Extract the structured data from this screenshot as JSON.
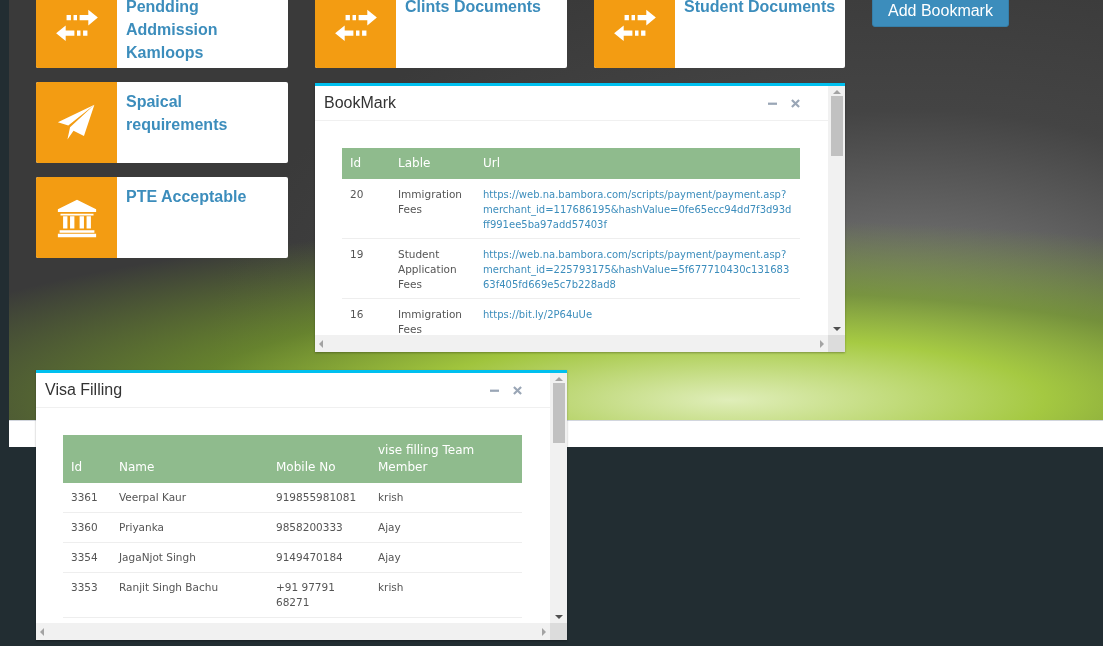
{
  "tiles": [
    {
      "title": "Pendding Addmission Kamloops",
      "kind": "exchange"
    },
    {
      "title": "Clints Documents",
      "kind": "exchange"
    },
    {
      "title": "Student Documents",
      "kind": "exchange"
    },
    {
      "title": "Spaical requirements",
      "kind": "plane"
    },
    {
      "title": "PTE Acceptable",
      "kind": "bank"
    }
  ],
  "add_button": "Add Bookmark",
  "windows": [
    {
      "title": "BookMark",
      "columns": [
        {
          "label": "Id",
          "kind": "text"
        },
        {
          "label": "Lable",
          "kind": "text"
        },
        {
          "label": "Url",
          "kind": "link"
        }
      ],
      "rows": [
        [
          "20",
          "Immigration Fees",
          "https://web.na.bambora.com/scripts/payment/payment.asp?merchant_id=117686195&hashValue=0fe65ecc94dd7f3d93dff991ee5ba97add57403f"
        ],
        [
          "19",
          "Student Application Fees",
          "https://web.na.bambora.com/scripts/payment/payment.asp?merchant_id=225793175&hashValue=5f677710430c13168363f405fd669e5c7b228ad8"
        ],
        [
          "16",
          "Immigration Fees",
          "https://bit.ly/2P64uUe"
        ]
      ]
    },
    {
      "title": "Visa Filling",
      "columns": [
        {
          "label": "Id",
          "kind": "text"
        },
        {
          "label": "Name",
          "kind": "text"
        },
        {
          "label": "Mobile No",
          "kind": "text"
        },
        {
          "label": "vise filling Team Member",
          "kind": "text"
        }
      ],
      "rows": [
        [
          "3361",
          "Veerpal Kaur",
          "919855981081",
          "krish"
        ],
        [
          "3360",
          "Priyanka",
          "9858200333",
          "Ajay"
        ],
        [
          "3354",
          "JagaNjot Singh",
          "9149470184",
          "Ajay"
        ],
        [
          "3353",
          "Ranjit Singh Bachu",
          "+91 97791 68271",
          "krish"
        ]
      ]
    }
  ]
}
